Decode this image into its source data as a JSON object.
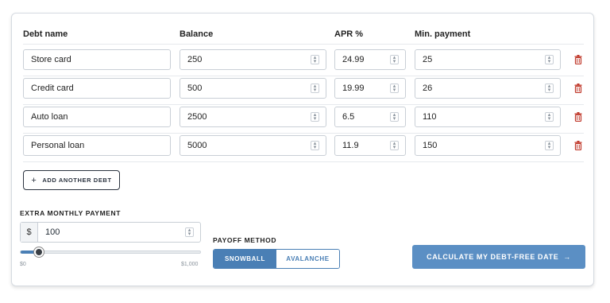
{
  "table": {
    "headers": {
      "name": "Debt name",
      "balance": "Balance",
      "apr": "APR %",
      "min": "Min. payment"
    },
    "rows": [
      {
        "name": "Store card",
        "balance": "250",
        "apr": "24.99",
        "min": "25"
      },
      {
        "name": "Credit card",
        "balance": "500",
        "apr": "19.99",
        "min": "26"
      },
      {
        "name": "Auto loan",
        "balance": "2500",
        "apr": "6.5",
        "min": "110"
      },
      {
        "name": "Personal loan",
        "balance": "5000",
        "apr": "11.9",
        "min": "150"
      }
    ]
  },
  "add_debt": {
    "icon": "+",
    "label": "ADD ANOTHER DEBT"
  },
  "extra": {
    "label": "EXTRA MONTHLY PAYMENT",
    "prefix": "$",
    "value": "100",
    "slider_min_label": "$0",
    "slider_max_label": "$1,000",
    "slider_fraction": 0.1
  },
  "payoff": {
    "label": "PAYOFF METHOD",
    "options": [
      "SNOWBALL",
      "AVALANCHE"
    ],
    "selected": "SNOWBALL"
  },
  "calculate": {
    "label": "CALCULATE MY DEBT-FREE DATE",
    "arrow": "→"
  },
  "colors": {
    "accent": "#4a7fb5",
    "button": "#5b8fc4",
    "delete": "#c0392b"
  },
  "icons": {
    "delete": "trash-icon",
    "spinner": "spinner-icon",
    "arrow": "arrow-right-icon"
  }
}
